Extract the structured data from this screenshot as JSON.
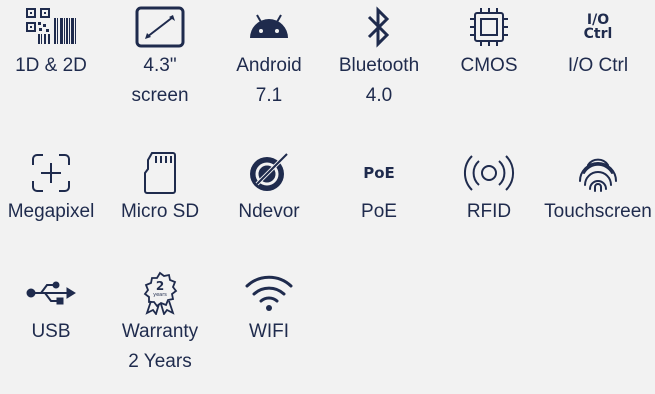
{
  "colors": {
    "background": "#f2f2f2",
    "accent": "#1f2b4d"
  },
  "features": [
    {
      "icon": "barcode-qr-icon",
      "label": "1D & 2D"
    },
    {
      "icon": "tablet-screen-icon",
      "label": "4.3\"\nscreen"
    },
    {
      "icon": "android-icon",
      "label": "Android\n7.1"
    },
    {
      "icon": "bluetooth-icon",
      "label": "Bluetooth\n4.0"
    },
    {
      "icon": "cmos-chip-icon",
      "label": "CMOS"
    },
    {
      "icon": "io-ctrl-icon",
      "label": "I/O Ctrl",
      "icon_text": "I/O\nCtrl"
    },
    {
      "icon": "megapixel-focus-icon",
      "label": "Megapixel"
    },
    {
      "icon": "micro-sd-card-icon",
      "label": "Micro SD"
    },
    {
      "icon": "ndevor-logo-icon",
      "label": "Ndevor"
    },
    {
      "icon": "poe-icon",
      "label": "PoE",
      "icon_text": "PoE"
    },
    {
      "icon": "rfid-icon",
      "label": "RFID"
    },
    {
      "icon": "touchscreen-fingerprint-icon",
      "label": "Touchscreen"
    },
    {
      "icon": "usb-icon",
      "label": "USB"
    },
    {
      "icon": "warranty-badge-icon",
      "label": "Warranty\n2 Years",
      "icon_text": "2",
      "icon_subtext": "years"
    },
    {
      "icon": "wifi-icon",
      "label": "WIFI"
    }
  ]
}
